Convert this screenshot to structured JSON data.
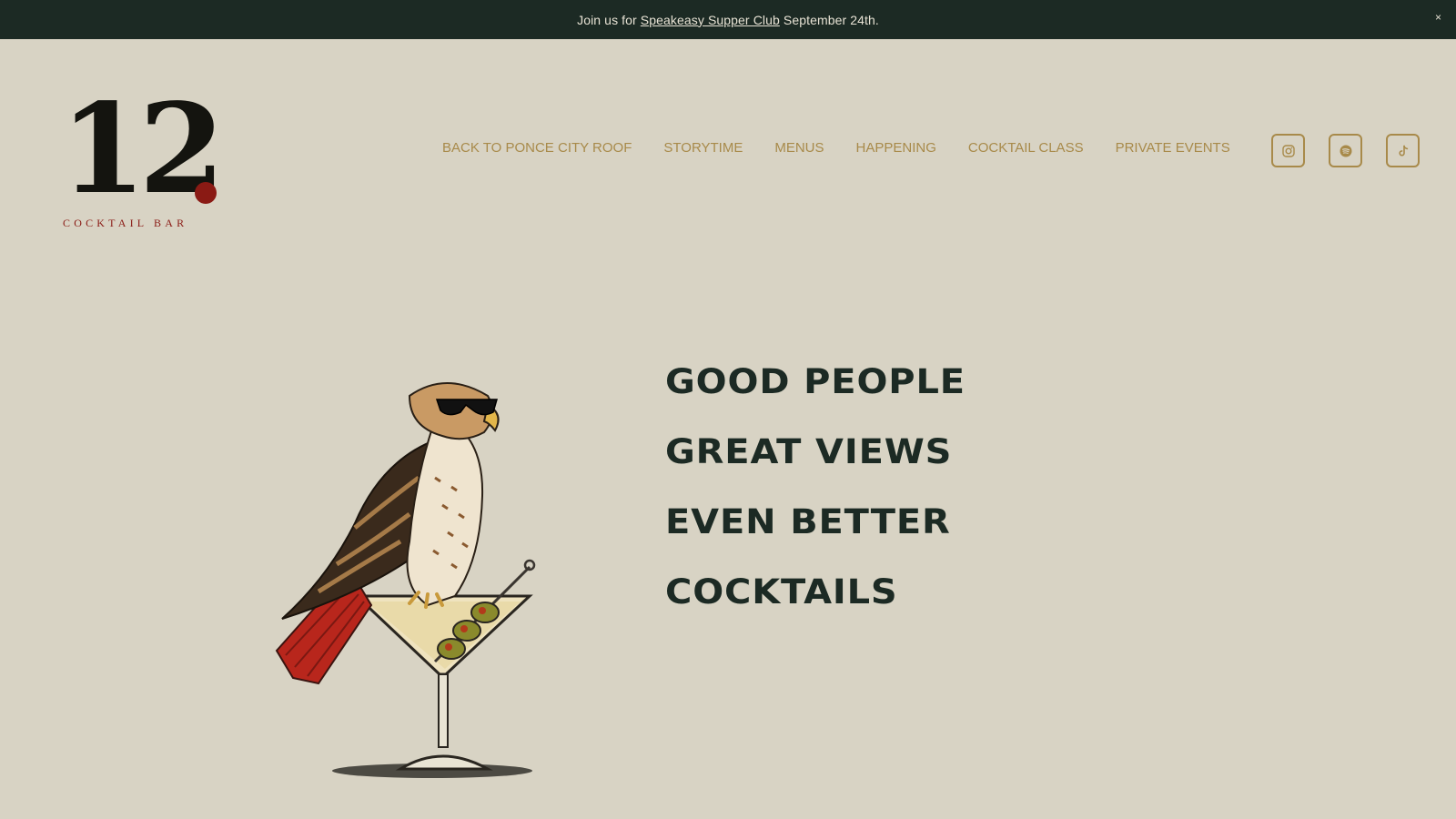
{
  "announcement": {
    "prefix": "Join us for ",
    "link_label": "Speakeasy Supper Club",
    "suffix": " September 24th.",
    "close_label": "×"
  },
  "logo": {
    "number": "12",
    "subtitle": "COCKTAIL BAR"
  },
  "nav": {
    "items": [
      {
        "label": "BACK TO PONCE CITY ROOF"
      },
      {
        "label": "STORYTIME"
      },
      {
        "label": "MENUS"
      },
      {
        "label": "HAPPENING"
      },
      {
        "label": "COCKTAIL CLASS"
      },
      {
        "label": "PRIVATE EVENTS"
      }
    ]
  },
  "socials": [
    {
      "icon": "instagram-icon"
    },
    {
      "icon": "spotify-icon"
    },
    {
      "icon": "tiktok-icon"
    }
  ],
  "hero": {
    "lines": [
      "GOOD PEOPLE",
      "GREAT VIEWS",
      "EVEN BETTER",
      "COCKTAILS"
    ],
    "illustration": "hawk-on-martini-glass"
  },
  "colors": {
    "background": "#d8d3c4",
    "announcement_bg": "#1c2a24",
    "nav_gold": "#a88a4a",
    "headline": "#1c2a24",
    "logo_red": "#8a1a14"
  }
}
